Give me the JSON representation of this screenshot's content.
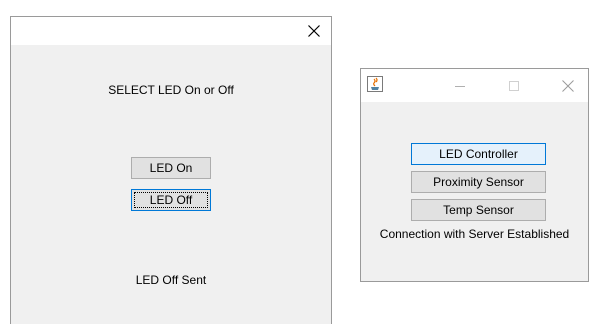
{
  "left_window": {
    "prompt": "SELECT LED On or Off",
    "buttons": {
      "led_on": "LED On",
      "led_off": "LED Off"
    },
    "status": "LED Off Sent",
    "titlebar_icons": [
      "close-icon"
    ]
  },
  "right_window": {
    "titlebar_icons": [
      "java-icon",
      "minimize-icon",
      "maximize-icon",
      "close-icon"
    ],
    "buttons": {
      "led_controller": "LED Controller",
      "proximity_sensor": "Proximity Sensor",
      "temp_sensor": "Temp Sensor"
    },
    "status": "Connection with Server Established"
  },
  "colors": {
    "window_bg": "#f0f0f0",
    "titlebar_bg": "#ffffff",
    "button_bg": "#e1e1e1",
    "button_border": "#adadad",
    "focus_border": "#0078d7",
    "hover_bg": "#e5f1fb"
  }
}
